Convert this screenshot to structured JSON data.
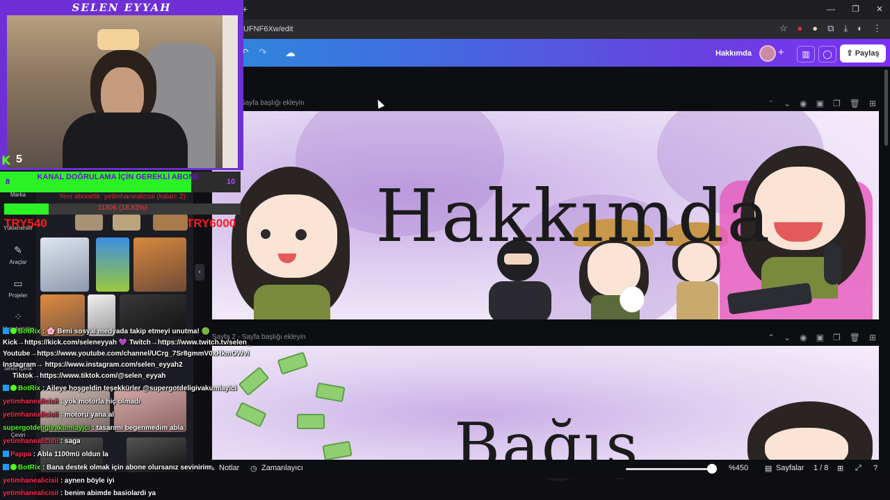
{
  "browser": {
    "new_tab": "+",
    "url": "UFNF6Xw/edit",
    "window_controls": [
      "—",
      "❐",
      "✕"
    ],
    "icons": [
      "star-icon",
      "record-icon",
      "extension-icon",
      "puzzle-icon",
      "download-icon",
      "profile-icon",
      "menu-icon"
    ]
  },
  "canva_header": {
    "undo": "↶",
    "redo": "↷",
    "title": "Hakkımda",
    "add": "+",
    "share_label": "Paylaş"
  },
  "pages": [
    {
      "label": "Sayfa başlığı ekleyin",
      "title": "Hakkımda"
    },
    {
      "label": "Sayfa 2 - Sayfa başlığı ekleyin",
      "title": "Bağış"
    }
  ],
  "sidebar": {
    "items": [
      {
        "label": "Marka"
      },
      {
        "label": "Yüklenenler"
      },
      {
        "label": "Araçlar"
      },
      {
        "label": "Projeler"
      },
      {
        "label": "Uygulamalar"
      },
      {
        "label": "Sihirli İçerik"
      },
      {
        "label": "Çeviri"
      }
    ]
  },
  "footer": {
    "notes": "Notlar",
    "timer": "Zamanlayıcı",
    "zoom": "%450",
    "zoom_fraction": 0.95,
    "pages_label": "Sayfalar",
    "page_count": "1 / 8"
  },
  "stream": {
    "webcam_title": "SELEN EYYAH",
    "viewer_count": "5",
    "goal_start": "8",
    "goal_end": "10",
    "goal_text": "KANAL DOĞRULAMA İÇİN GEREKLİ ABONE",
    "sub_text": "Yeni abonelik: yetimhanealicisii (kalan: 2)",
    "donation_text": "1130₺ (18.83%)",
    "donation_left": "TRY540",
    "donation_right": "TRY6000"
  },
  "chat": [
    {
      "user": "BotRix",
      "text": ": 🌸 Beni sosyal medyada takip etmeyi unutma! 🟢",
      "kind": "bot"
    },
    {
      "user": "",
      "text": "Kick→https://kick.com/seleneyyah 💜 Twitch→https://www.twitch.tv/selen_",
      "kind": "plain"
    },
    {
      "user": "",
      "text": "Youtube→https://www.youtube.com/channel/UCrg_7Sr8gmmV0xHkmOWvi",
      "kind": "plain"
    },
    {
      "user": "",
      "text": "Instagram→ https://www.instagram.com/selen_eyyah2",
      "kind": "plain"
    },
    {
      "user": "",
      "text": "Tiktok→https://www.tiktok.com/@selen_eyyah",
      "kind": "plain"
    },
    {
      "user": "BotRix",
      "text": ": Aileye hoşgeldin teşekkürler @supergotdeligivakumlayici",
      "kind": "bot"
    },
    {
      "user": "yetimhanealicisii",
      "text": ": yok motorla hiç olmadı",
      "kind": "red"
    },
    {
      "user": "yetimhanealicisii",
      "text": ": motoru yana al",
      "kind": "red"
    },
    {
      "user": "supergotdeligivakumlayici",
      "text": ": tasarımı begenmedim abla",
      "kind": "green"
    },
    {
      "user": "yetimhanealicisii",
      "text": ": saga",
      "kind": "red"
    },
    {
      "user": "Pappa",
      "text": ": Abla 1100mü oldun la",
      "kind": "red"
    },
    {
      "user": "BotRix",
      "text": ": Bana destek olmak için abone olursanız sevinirim",
      "kind": "bot"
    },
    {
      "user": "yetimhanealicisii",
      "text": ": aynen böyle iyi",
      "kind": "red"
    },
    {
      "user": "yetimhanealicisii",
      "text": ": benim abimde basiolardi ya",
      "kind": "red"
    }
  ]
}
